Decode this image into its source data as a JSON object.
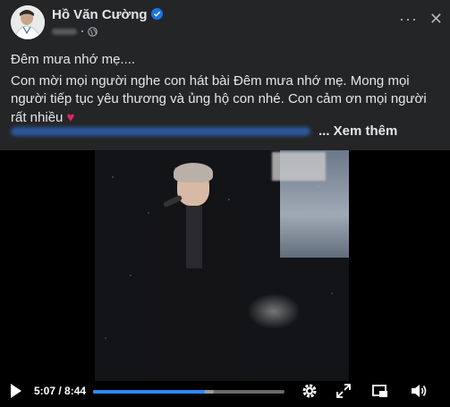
{
  "post": {
    "author": "Hồ Văn Cường",
    "verified_icon": "verified-badge-icon",
    "privacy_icon": "globe-icon",
    "more_icon": "more-options-icon",
    "close_icon": "close-icon",
    "more_glyph": "···",
    "close_glyph": "✕"
  },
  "caption": {
    "line1": "Đêm mưa nhớ mẹ....",
    "line2": "Con mời mọi người nghe con hát bài Đêm mưa nhớ mẹ. Mong mọi người tiếp tục yêu thương và ủng hộ con nhé. Con cảm ơn mọi người rất nhiều",
    "heart": "♥",
    "see_more": "... Xem thêm"
  },
  "video": {
    "current_time": "5:07",
    "separator": "/",
    "duration": "8:44",
    "time_display": "5:07 / 8:44",
    "progress": 0.586,
    "buffered": 0.63,
    "accent_color": "#2d88ff",
    "controls": {
      "play_icon": "play-icon",
      "settings_icon": "settings-gear-icon",
      "expand_icon": "expand-icon",
      "pip_icon": "picture-in-picture-icon",
      "volume_icon": "volume-icon"
    }
  }
}
